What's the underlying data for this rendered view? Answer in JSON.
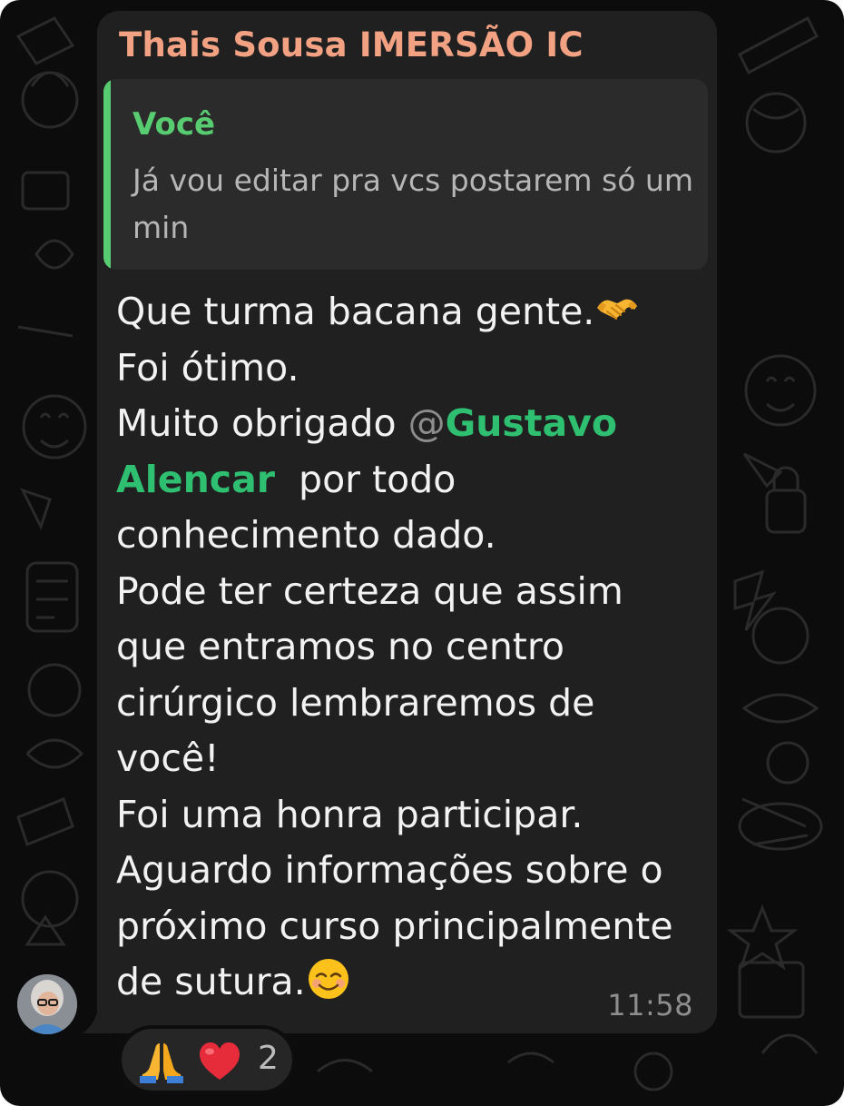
{
  "message": {
    "sender_name": "Thais Sousa IMERSÃO IC",
    "sender_color": "#f2a282",
    "quoted": {
      "author": "Você",
      "text": "Já vou editar pra vcs postarem só um min",
      "accent_color": "#58cc70"
    },
    "body": {
      "line1": "Que turma bacana gente.",
      "line1_emoji": "handshake",
      "line2": "Foi ótimo.",
      "thanks_before": "Muito obrigado ",
      "mention_at": "@",
      "mention_name_1": "Gustavo",
      "mention_name_2": "Alencar",
      "mention_color": "#2fbf71",
      "thanks_after": "  por todo",
      "line4": "conhecimento dado.",
      "line5": "Pode ter certeza que assim",
      "line6": "que entramos no centro",
      "line7": "cirúrgico lembraremos de",
      "line8": "você!",
      "line9": "Foi uma honra participar.",
      "line10": "Aguardo informações sobre o",
      "line11": "próximo curso principalmente",
      "line12": "de sutura.",
      "line12_emoji": "smiling-face"
    },
    "time": "11:58"
  },
  "reactions": {
    "emojis": [
      "folded-hands",
      "red-heart"
    ],
    "count": "2"
  },
  "avatar": {
    "icon": "user-avatar"
  }
}
